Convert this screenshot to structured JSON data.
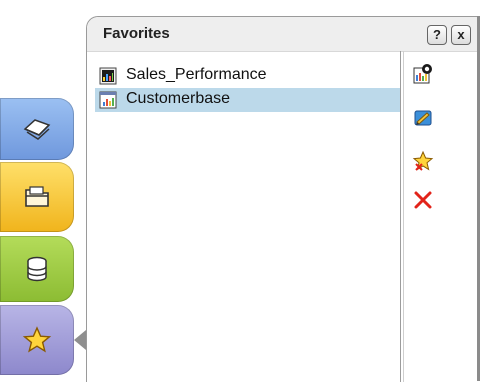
{
  "panel": {
    "title": "Favorites",
    "help_label": "?",
    "close_label": "x"
  },
  "favorites": [
    {
      "label": "Sales_Performance",
      "icon": "dashboard-icon",
      "selected": false
    },
    {
      "label": "Customerbase",
      "icon": "report-chart-icon",
      "selected": true
    }
  ],
  "left_tabs": [
    {
      "name": "tab-envelope",
      "icon": "envelope-icon",
      "color": "#8fb3ec"
    },
    {
      "name": "tab-folder",
      "icon": "folder-icon",
      "color": "#f4c52c"
    },
    {
      "name": "tab-database",
      "icon": "database-icon",
      "color": "#9ccb45"
    },
    {
      "name": "tab-favorites",
      "icon": "star-icon",
      "color": "#a8a4dc",
      "selected": true
    }
  ],
  "toolbar": [
    {
      "name": "open-favorite-icon"
    },
    {
      "name": "edit-favorite-icon"
    },
    {
      "name": "remove-favorite-star-icon"
    },
    {
      "name": "delete-icon"
    }
  ],
  "colors": {
    "selection": "#bcd9ea",
    "header_bg": "#eeeeee",
    "delete_red": "#e2231a"
  }
}
